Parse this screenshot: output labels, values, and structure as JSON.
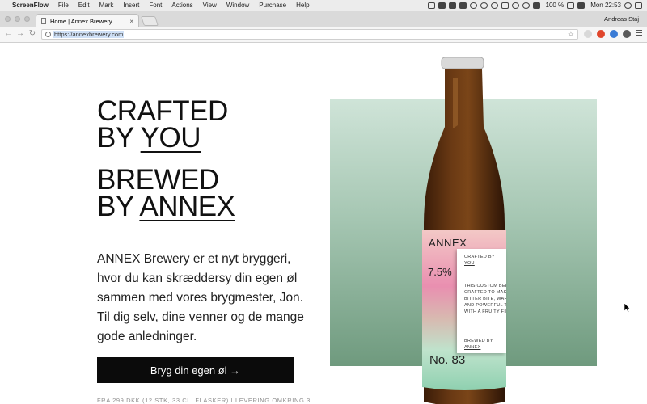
{
  "menubar": {
    "app_name": "ScreenFlow",
    "items": [
      "File",
      "Edit",
      "Mark",
      "Insert",
      "Font",
      "Actions",
      "View",
      "Window",
      "Purchase",
      "Help"
    ],
    "battery": "100 %",
    "clock": "Mon 22:53"
  },
  "browser": {
    "tab_title": "Home | Annex Brewery",
    "tab_close": "×",
    "profile_name": "Andreas Staj",
    "url": "https://annexbrewery.com",
    "back_icon": "back-arrow-icon",
    "forward_icon": "forward-arrow-icon",
    "reload_icon": "reload-icon",
    "star_icon": "bookmark-star-icon"
  },
  "hero": {
    "line1": "CRAFTED",
    "line2_prefix": "BY",
    "line2_link": "YOU",
    "line3": "BREWED",
    "line4_prefix": "BY",
    "line4_link": "ANNEX",
    "description": "ANNEX Brewery er et nyt bryggeri, hvor du kan skræddersy din egen øl sammen med vores brygmester, Jon. Til dig selv, dine venner og de mange gode anledninger.",
    "cta_label": "Bryg din egen øl →",
    "footnote": "FRA 299 DKK (12 STK, 33 CL. FLASKER) I LEVERING OMKRING 3"
  },
  "bottle_label": {
    "brand": "ANNEX",
    "abv": "7.5%",
    "number": "No. 83",
    "crafted_by": "CRAFTED BY",
    "crafted_name": "YOU",
    "description_lines": [
      "THIS CUSTOM BEER",
      "CRAFTED TO MAKE",
      "BITTER BITE, WARM",
      "AND POWERFUL TAS",
      "WITH A FRUITY FIN"
    ],
    "brewed_by": "BREWED BY",
    "brewed_name": "ANNEX"
  },
  "colors": {
    "cta_bg": "#0b0b0b",
    "panel_top": "#cfe4d8",
    "panel_bottom": "#6f9a7e",
    "bottle_glass": "#5a2f10"
  }
}
